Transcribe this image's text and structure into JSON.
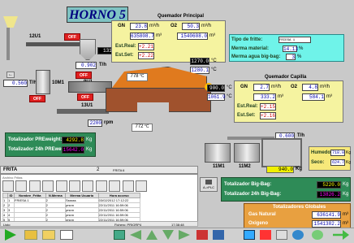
{
  "title": "HORNO 5",
  "top": {
    "pump_label": "12U1",
    "off1": "OFF",
    "weight1": "131.8",
    "weight1_unit": "Kg",
    "flow_902": "0.902",
    "flow_902_unit": "T/h",
    "tag_10m1": "10M1",
    "tag_9u1": "9U1",
    "off2": "OFF",
    "off3": "OFF",
    "off4": "OFF",
    "tag_13u1": "13U1",
    "speed_rpm": "2200",
    "speed_unit": "rpm",
    "flow_560": "0.560",
    "flow_560_unit": "T/h"
  },
  "quemador_principal": {
    "title": "Quemador Principal",
    "gn_label": "GN",
    "gn_value": "23.8",
    "gn_unit": "m³/h",
    "o2_label": "O2",
    "o2_value": "50.3",
    "o2_unit": "m³/h",
    "gn_total": "635808.7",
    "gn_total_unit": "m³",
    "o2_total": "1540608.0",
    "o2_total_unit": "m³",
    "est_real_label": "Est.Real:",
    "est_real_value": "+2.21",
    "est_set_label": "Est.Set:",
    "est_set_value": "+2.22"
  },
  "temps": {
    "t1": "1270.0",
    "t2": "1280.1",
    "t3": "778",
    "t4": "900.0",
    "t5": "1061.9",
    "t6": "772",
    "unit": "°C"
  },
  "info_box": {
    "frit_label": "Tipo de fritte:",
    "frit_value": "FRIESA 1",
    "merma_label": "Merma material:",
    "merma_value": "14.13",
    "merma_unit": "%",
    "agua_label": "Merma agua big-bag:",
    "agua_value": "3",
    "agua_unit": "%"
  },
  "quemador_capilla": {
    "title": "Quemador Capilla",
    "gn_label": "GN",
    "gn_value": "2.7",
    "gn_unit": "m³/h",
    "o2_label": "O2",
    "o2_value": "4.8",
    "o2_unit": "m³/h",
    "gn_total": "333.2",
    "gn_total_unit": "m³",
    "o2_total": "584.1",
    "o2_total_unit": "m³",
    "est_real_label": "Est.Real:",
    "est_real_value": "+2.15",
    "est_set_label": "Est.Set:",
    "est_set_value": "+2.16"
  },
  "right_process": {
    "flow_600": "0.600",
    "flow_600_unit": "T/h",
    "humedo_label": "Humedo:",
    "humedo_value": "718.0",
    "humedo_unit": "Kg",
    "seco_label": "Seco:",
    "seco_value": "624.7",
    "seco_unit": "Kg",
    "bag_weight": "940.0",
    "bag_weight_unit": "Kg",
    "tag_11m1": "11M1",
    "tag_11m2": "11M2"
  },
  "totalizers_left": {
    "pre_label": "Totalizador PREweight:",
    "pre_value": "4292.8",
    "pre_unit": "Kg",
    "pre24_label": "Totalizador 24h PREweight:",
    "pre24_value": "15642.0",
    "pre24_unit": "Kg"
  },
  "totalizers_right": {
    "bb_label": "Totalizador Big-Bag:",
    "bb_value": "5220.0",
    "bb_unit": "Kg",
    "bb24_label": "Totalizador 24h Big-Bag:",
    "bb24_value": "13826.2",
    "bb24_unit": "Kg",
    "gases_title": "Totalizadores Globales",
    "gas_label": "Gas Natural",
    "gas_value": "636141.9",
    "gas_unit": "m³",
    "oxi_label": "Oxigeno",
    "oxi_value": "1541382.2",
    "oxi_unit": "m³"
  },
  "bottom_grid": {
    "header_left": "FRITA",
    "header_mid": "2",
    "header_right": "FRITA 6",
    "subtitle": "Archivo Fritas",
    "columns": [
      "",
      "ID",
      "Nombre_Fritta",
      "N.Merma",
      "Merma Usuario",
      "Hora acceso"
    ],
    "rows": [
      [
        "1",
        "1",
        "FRIESA 1",
        "2",
        "Ssssss",
        "03/02/2012 17:12:22"
      ],
      [
        "2",
        "2",
        "",
        "2",
        "prsnn",
        "22/11/2011 16:59:06"
      ],
      [
        "3",
        "3",
        "",
        "2",
        "prsnn",
        "22/11/2011 16:59:06"
      ],
      [
        "4",
        "4",
        "",
        "2",
        "prsnn",
        "22/11/2011 16:59:06"
      ],
      [
        "5",
        "5",
        "",
        "2",
        "prsnn",
        "22/11/2011 16:59:06"
      ],
      [
        "6",
        "6",
        "",
        "2",
        "prsnn",
        "22/11/2011 16:59:06"
      ]
    ],
    "footer_left": "Listo",
    "footer_mid": "Fichero: PRIORP4",
    "footer_right": "17:38:48",
    "plc_label": "A->PLC"
  },
  "colors": {
    "accent_yellow": "#f5f3a0",
    "accent_green": "#2e8b57",
    "orange_furnace": "#e07a1e",
    "brown_furnace": "#a0522d",
    "cyan_panel": "#6ff3e9"
  }
}
